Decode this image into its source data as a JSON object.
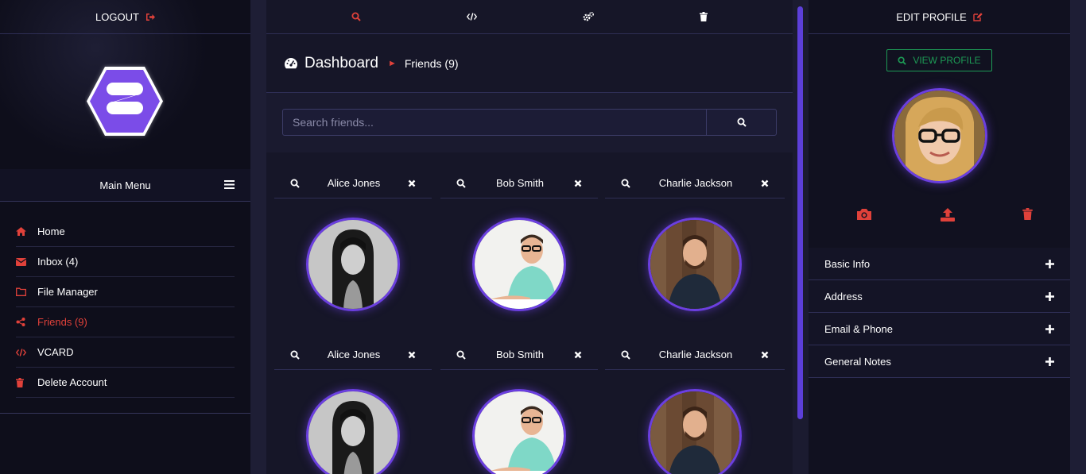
{
  "left": {
    "logout_label": "LOGOUT",
    "main_menu_label": "Main Menu",
    "nav": [
      {
        "icon": "home-icon",
        "label": "Home",
        "active": false
      },
      {
        "icon": "envelope-icon",
        "label": "Inbox (4)",
        "active": false
      },
      {
        "icon": "folder-icon",
        "label": "File Manager",
        "active": false
      },
      {
        "icon": "share-icon",
        "label": "Friends (9)",
        "active": true
      },
      {
        "icon": "code-icon",
        "label": "VCARD",
        "active": false
      },
      {
        "icon": "trash-icon",
        "label": "Delete Account",
        "active": false
      }
    ]
  },
  "center": {
    "toolbar": [
      "search-icon",
      "code-icon",
      "gears-icon",
      "trash-icon"
    ],
    "breadcrumb": {
      "title": "Dashboard",
      "current": "Friends (9)"
    },
    "search": {
      "placeholder": "Search friends..."
    },
    "friends": [
      {
        "name": "Alice Jones"
      },
      {
        "name": "Bob Smith"
      },
      {
        "name": "Charlie Jackson"
      },
      {
        "name": "Alice Jones"
      },
      {
        "name": "Bob Smith"
      },
      {
        "name": "Charlie Jackson"
      }
    ]
  },
  "right": {
    "edit_profile_label": "EDIT PROFILE",
    "view_profile_label": "VIEW PROFILE",
    "photo_actions": [
      "camera-icon",
      "upload-icon",
      "trash-icon"
    ],
    "sections": [
      {
        "label": "Basic Info"
      },
      {
        "label": "Address"
      },
      {
        "label": "Email & Phone"
      },
      {
        "label": "General Notes"
      }
    ]
  },
  "colors": {
    "accent_red": "#e0413a",
    "accent_purple": "#6b3fe0",
    "accent_green": "#1d9a55"
  }
}
